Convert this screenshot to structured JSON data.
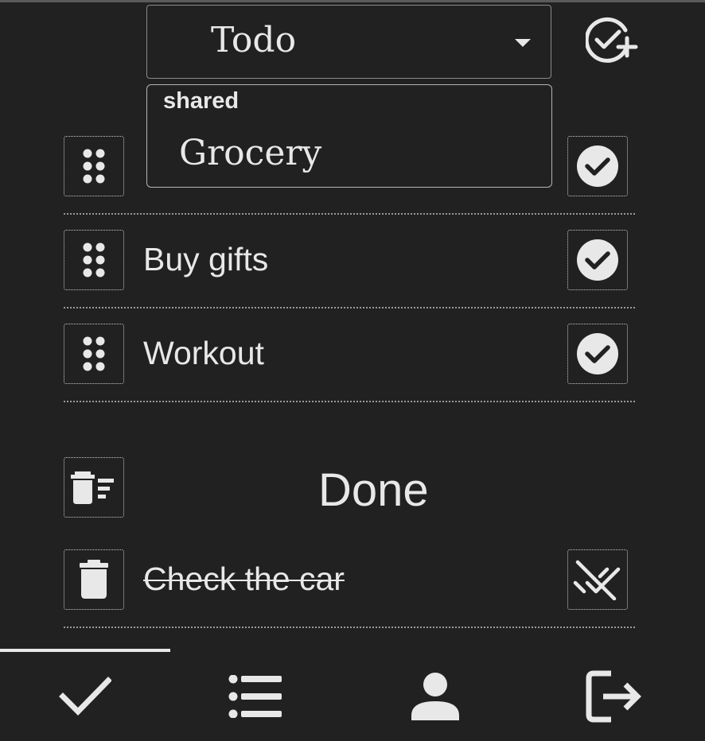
{
  "list_selector": {
    "selected": "Todo",
    "menu": {
      "group_label": "shared",
      "options": [
        "Grocery"
      ]
    }
  },
  "add_list_icon": "add-check-circle-icon",
  "todo_items": [
    {
      "label": "Buy gifts"
    },
    {
      "label": "Workout"
    }
  ],
  "done_section": {
    "title": "Done",
    "items": [
      {
        "label": "Check the car",
        "completed": true
      }
    ]
  },
  "bottom_nav": {
    "items": [
      {
        "name": "todos",
        "icon": "check-icon",
        "active": true
      },
      {
        "name": "lists",
        "icon": "list-icon",
        "active": false
      },
      {
        "name": "account",
        "icon": "person-icon",
        "active": false
      },
      {
        "name": "logout",
        "icon": "logout-icon",
        "active": false
      }
    ]
  },
  "colors": {
    "background": "#212121",
    "foreground": "#e8e8e8",
    "border": "#8a8a8a"
  }
}
